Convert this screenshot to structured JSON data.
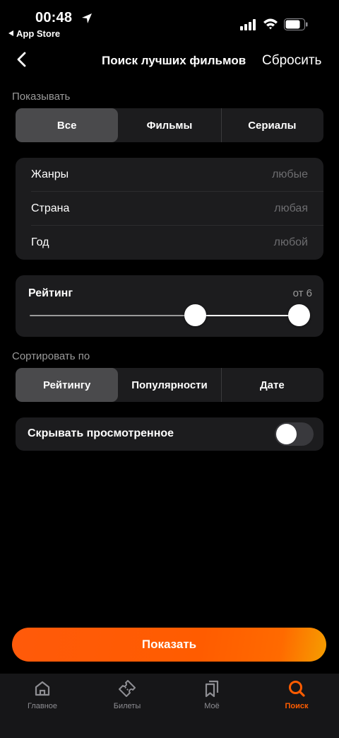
{
  "status_bar": {
    "time": "00:48",
    "back_app": "App Store"
  },
  "nav": {
    "title": "Поиск лучших фильмов",
    "reset_label": "Сбросить"
  },
  "show_section": {
    "label": "Показывать",
    "options": [
      "Все",
      "Фильмы",
      "Сериалы"
    ],
    "selected": "Все"
  },
  "filters": [
    {
      "label": "Жанры",
      "value": "любые"
    },
    {
      "label": "Страна",
      "value": "любая"
    },
    {
      "label": "Год",
      "value": "любой"
    }
  ],
  "rating": {
    "label": "Рейтинг",
    "value_text": "от 6"
  },
  "sort_section": {
    "label": "Сортировать по",
    "options": [
      "Рейтингу",
      "Популярности",
      "Дате"
    ],
    "selected": "Рейтингу"
  },
  "hide_watched": {
    "label": "Скрывать просмотренное",
    "enabled": false
  },
  "show_button": {
    "label": "Показать"
  },
  "tabbar": {
    "items": [
      {
        "label": "Главное",
        "icon": "home-icon"
      },
      {
        "label": "Билеты",
        "icon": "ticket-icon"
      },
      {
        "label": "Моё",
        "icon": "bookmarks-icon"
      },
      {
        "label": "Поиск",
        "icon": "search-icon"
      }
    ],
    "active": "Поиск"
  },
  "colors": {
    "accent": "#ff5c00",
    "background": "#000000",
    "card": "#1c1c1e",
    "segment_active": "#4a4a4c"
  }
}
